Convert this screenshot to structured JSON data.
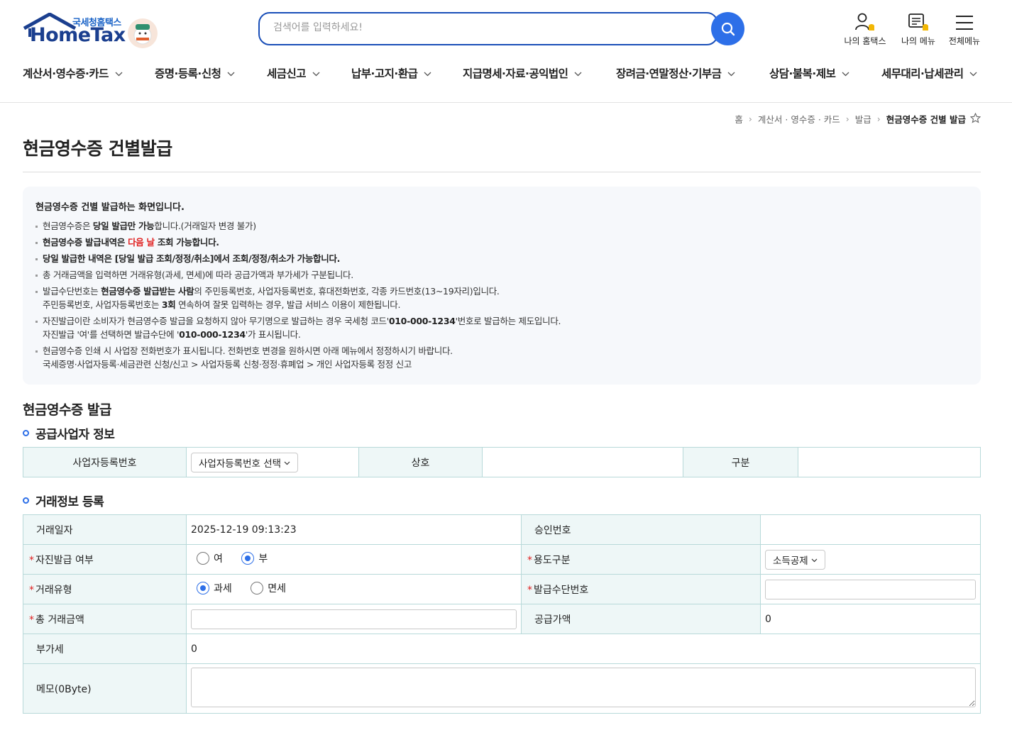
{
  "header": {
    "logo_sub": "국세청홈택스",
    "logo_main": "HomeTax",
    "search_placeholder": "검색어를 입력하세요!",
    "util": [
      {
        "label": "나의 홈택스",
        "icon": "user-bell-icon"
      },
      {
        "label": "나의 메뉴",
        "icon": "menu-bell-icon"
      },
      {
        "label": "전체메뉴",
        "icon": "hamburger-icon"
      }
    ],
    "gnb": [
      "계산서·영수증·카드",
      "증명·등록·신청",
      "세금신고",
      "납부·고지·환급",
      "지급명세·자료·공익법인",
      "장려금·연말정산·기부금",
      "상담·불복·제보",
      "세무대리·납세관리"
    ]
  },
  "breadcrumb": {
    "items": [
      "홈",
      "계산서 · 영수증 · 카드",
      "발급"
    ],
    "current": "현금영수증 건별 발급"
  },
  "page_title": "현금영수증 건별발급",
  "info": {
    "head": "현금영수증 건별 발급하는 화면입니다.",
    "l1a": "현금영수증은 ",
    "l1b": "당일 발급만 가능",
    "l1c": "합니다.(거래일자 변경 불가)",
    "l2a": "현금영수증 발급내역은 ",
    "l2b": "다음 날",
    "l2c": " 조회 가능합니다.",
    "l3": "당일 발급한 내역은 [당일 발급 조회/정정/취소]에서 조회/정정/취소가 가능합니다.",
    "l4": "총 거래금액을 입력하면 거래유형(과세, 면세)에 따라 공급가액과 부가세가 구분됩니다.",
    "l5a": "발급수단번호는 ",
    "l5b": "현금영수증 발급받는 사람",
    "l5c": "의  주민등록번호, 사업자등록번호, 휴대전화번호, 각종 카드번호(13~19자리)입니다.",
    "l5d": "주민등록번호, 사업자등록번호는 ",
    "l5e": "3회",
    "l5f": " 연속하여 잘못 입력하는 경우, 발급 서비스 이용이 제한됩니다.",
    "l6a": "자진발급이란 소비자가 현금영수증 발급을 요청하지 않아 무기명으로 발급하는 경우 국세청 코드'",
    "l6b": "010-000-1234",
    "l6c": "'번호로 발급하는 제도입니다.",
    "l6d": "자진발급 '여'를 선택하면 발급수단에 '",
    "l6e": "010-000-1234",
    "l6f": "'가 표시됩니다.",
    "l7a": "현금영수증 인쇄 시 사업장 전화번호가 표시됩니다. 전화번호 변경을 원하시면 아래 메뉴에서 정정하시기 바랍니다.",
    "l7b": "국세증명·사업자등록·세금관련 신청/신고 > 사업자등록 신청·정정·휴폐업 > 개인 사업자등록 정정 신고"
  },
  "section_title": "현금영수증 발급",
  "supplier": {
    "title": "공급사업자 정보",
    "brn_label": "사업자등록번호",
    "brn_select": "사업자등록번호 선택",
    "name_label": "상호",
    "name_value": "",
    "type_label": "구분",
    "type_value": ""
  },
  "trade": {
    "title": "거래정보 등록",
    "date_label": "거래일자",
    "date_value": "2025-12-19 09:13:23",
    "approval_label": "승인번호",
    "approval_value": "",
    "self_label": "자진발급 여부",
    "self_yes": "여",
    "self_no": "부",
    "self_selected": "부",
    "usage_label": "용도구분",
    "usage_value": "소득공제",
    "type_label": "거래유형",
    "type_taxable": "과세",
    "type_exempt": "면세",
    "type_selected": "과세",
    "means_label": "발급수단번호",
    "means_value": "",
    "total_label": "총 거래금액",
    "total_value": "",
    "supply_label": "공급가액",
    "supply_value": "0",
    "vat_label": "부가세",
    "vat_value": "0",
    "memo_label": "메모(0Byte)",
    "memo_value": ""
  },
  "colors": {
    "brand": "#1b3f8f",
    "accent": "#2d6fe8",
    "required": "#e02020",
    "table_border": "#b8d9d9",
    "table_head_bg": "#eef7f7"
  }
}
